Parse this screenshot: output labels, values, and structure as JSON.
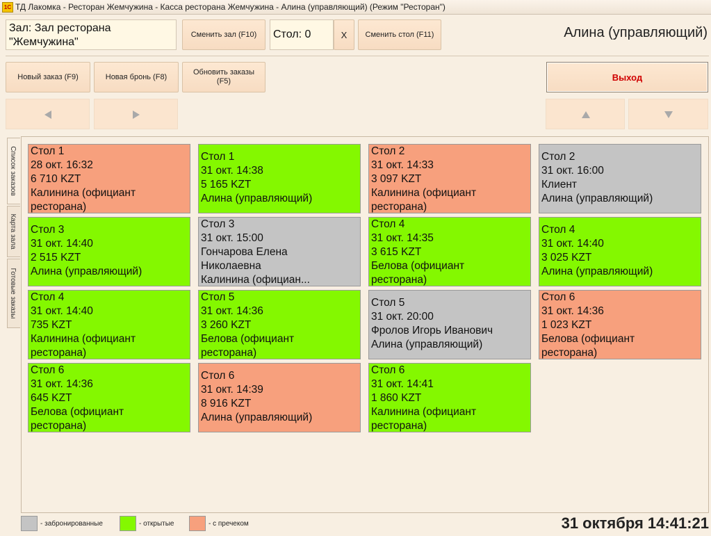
{
  "window": {
    "logo": "1С",
    "title": "ТД Лакомка - Ресторан Жемчужина - Касса ресторана Жемчужина - Алина  (управляющий) (Режим \"Ресторан\")"
  },
  "header": {
    "hall_label": "Зал: Зал ресторана \"Жемчужина\"",
    "change_hall": "Сменить зал (F10)",
    "table_field": "Стол: 0",
    "clear": "X",
    "change_table": "Сменить стол (F11)",
    "user": "Алина  (управляющий)"
  },
  "toolbar": {
    "new_order": "Новый заказ (F9)",
    "new_booking": "Новая бронь (F8)",
    "refresh": "Обновить заказы (F5)",
    "exit": "Выход"
  },
  "nav": {
    "left_icon": "arrow-left-icon",
    "right_icon": "arrow-right-icon",
    "up_icon": "arrow-up-icon",
    "down_icon": "arrow-down-icon"
  },
  "tabs": [
    "Список заказов",
    "Карта зала",
    "Готовые заказы"
  ],
  "colors": {
    "booked": "#c4c4c4",
    "open": "#84f800",
    "precheck": "#f7a07d",
    "exit_text": "#d00000"
  },
  "orders": [
    {
      "status": "precheck",
      "lines": [
        "Стол 1",
        "28 окт. 16:32",
        "6 710 KZT",
        "Калинина (официант",
        "ресторана)"
      ]
    },
    {
      "status": "open",
      "lines": [
        "Стол 1",
        "31 окт. 14:38",
        "5 165 KZT",
        "Алина  (управляющий)"
      ]
    },
    {
      "status": "precheck",
      "lines": [
        "Стол 2",
        "31 окт. 14:33",
        "3 097 KZT",
        "Калинина (официант",
        "ресторана)"
      ]
    },
    {
      "status": "booked",
      "lines": [
        "Стол 2",
        "31 окт. 16:00",
        "Клиент",
        "Алина  (управляющий)"
      ]
    },
    {
      "status": "open",
      "lines": [
        "Стол 3",
        "31 окт. 14:40",
        "2 515 KZT",
        "Алина  (управляющий)"
      ]
    },
    {
      "status": "booked",
      "lines": [
        "Стол 3",
        "31 окт. 15:00",
        "Гончарова Елена",
        "Николаевна",
        "Калинина (официан..."
      ]
    },
    {
      "status": "open",
      "lines": [
        "Стол 4",
        "31 окт. 14:35",
        "3 615 KZT",
        "Белова (официант",
        "ресторана)"
      ]
    },
    {
      "status": "open",
      "lines": [
        "Стол 4",
        "31 окт. 14:40",
        "3 025 KZT",
        "Алина  (управляющий)"
      ]
    },
    {
      "status": "open",
      "lines": [
        "Стол 4",
        "31 окт. 14:40",
        "735 KZT",
        "Калинина (официант",
        "ресторана)"
      ]
    },
    {
      "status": "open",
      "lines": [
        "Стол 5",
        "31 окт. 14:36",
        "3 260 KZT",
        "Белова (официант",
        "ресторана)"
      ]
    },
    {
      "status": "booked",
      "lines": [
        "Стол 5",
        "31 окт. 20:00",
        "Фролов Игорь Иванович",
        "Алина  (управляющий)"
      ]
    },
    {
      "status": "precheck",
      "lines": [
        "Стол 6",
        "31 окт. 14:36",
        "1 023 KZT",
        "Белова (официант",
        "ресторана)"
      ]
    },
    {
      "status": "open",
      "lines": [
        "Стол 6",
        "31 окт. 14:36",
        "645 KZT",
        "Белова (официант",
        "ресторана)"
      ]
    },
    {
      "status": "precheck",
      "lines": [
        "Стол 6",
        "31 окт. 14:39",
        "8 916 KZT",
        "Алина  (управляющий)"
      ]
    },
    {
      "status": "open",
      "lines": [
        "Стол 6",
        "31 окт. 14:41",
        "1 860 KZT",
        "Калинина (официант",
        "ресторана)"
      ]
    }
  ],
  "legend": {
    "booked": "- забронированные",
    "open": "- открытые",
    "precheck": "- с пречеком"
  },
  "clock": "31 октября 14:41:21"
}
